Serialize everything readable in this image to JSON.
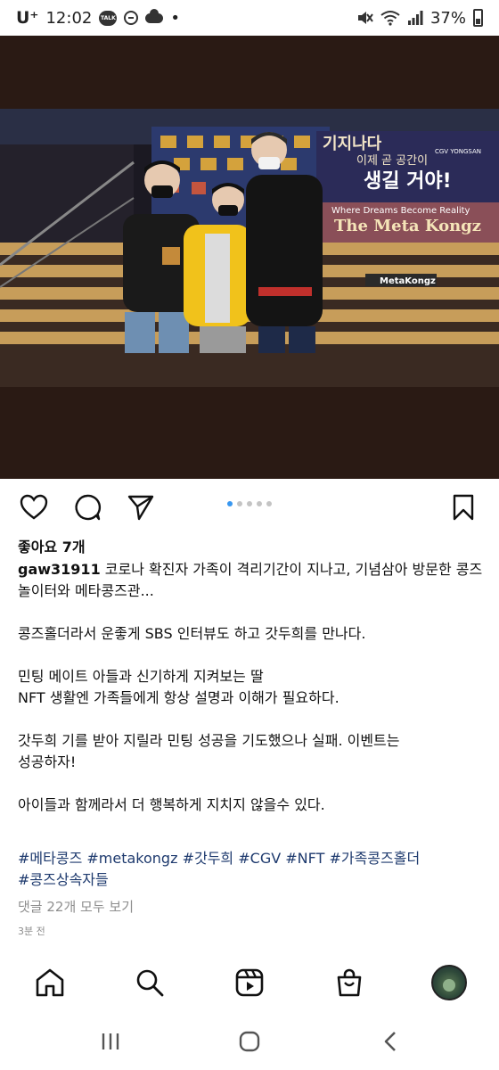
{
  "status_bar": {
    "carrier": "U⁺",
    "time": "12:02",
    "talk_badge": "TALK",
    "battery": "37%",
    "dot": "•"
  },
  "photo": {
    "banner_line1": "기지나다",
    "banner_line2": "이제 곧 공간이",
    "banner_line3": "생길 거야!",
    "banner_tagline": "Where Dreams Become Reality",
    "banner_title": "The Meta Kongz",
    "floor_logo": "MetaKongz",
    "side_sign": "CGV YONGSAN"
  },
  "post": {
    "likes": "좋아요 7개",
    "username": "gaw31911",
    "caption_first": " 코로나 확진자 가족이 격리기간이 지나고, 기념삼아 방문한 콩즈놀이터와 메타콩즈관...",
    "lines": [
      "콩즈홀더라서 운좋게 SBS 인터뷰도 하고 갓두희를 만나다.",
      "민팅 메이트 아들과 신기하게 지켜보는 딸",
      "NFT 생활엔 가족들에게 항상 설명과 이해가 필요하다.",
      "갓두희 기를 받아 지릴라 민팅 성공을 기도했으나 실패. 이벤트는",
      "성공하자!",
      "아이들과 함께라서 더 행복하게 지치지 않을수 있다."
    ],
    "hashtags": [
      "#메타콩즈",
      "#metakongz",
      "#갓두희",
      "#CGV",
      "#NFT",
      "#가족콩즈홀더",
      "#콩즈상속자들"
    ],
    "comments_link": "댓글 22개 모두 보기",
    "time_ago": "3분 전",
    "carousel": {
      "count": 5,
      "active": 0
    }
  },
  "icons": {
    "like": "heart-icon",
    "comment": "comment-icon",
    "share": "send-icon",
    "save": "bookmark-icon",
    "home": "home-icon",
    "search": "search-icon",
    "reels": "reels-icon",
    "shop": "shop-icon",
    "recents": "recents-icon",
    "system_home": "system-home-icon",
    "back": "back-icon"
  },
  "colors": {
    "hashtag": "#1e3a6e",
    "muted": "#8e8e8e",
    "carousel_active": "#3897f0",
    "media_bg": "#2a1a14"
  }
}
